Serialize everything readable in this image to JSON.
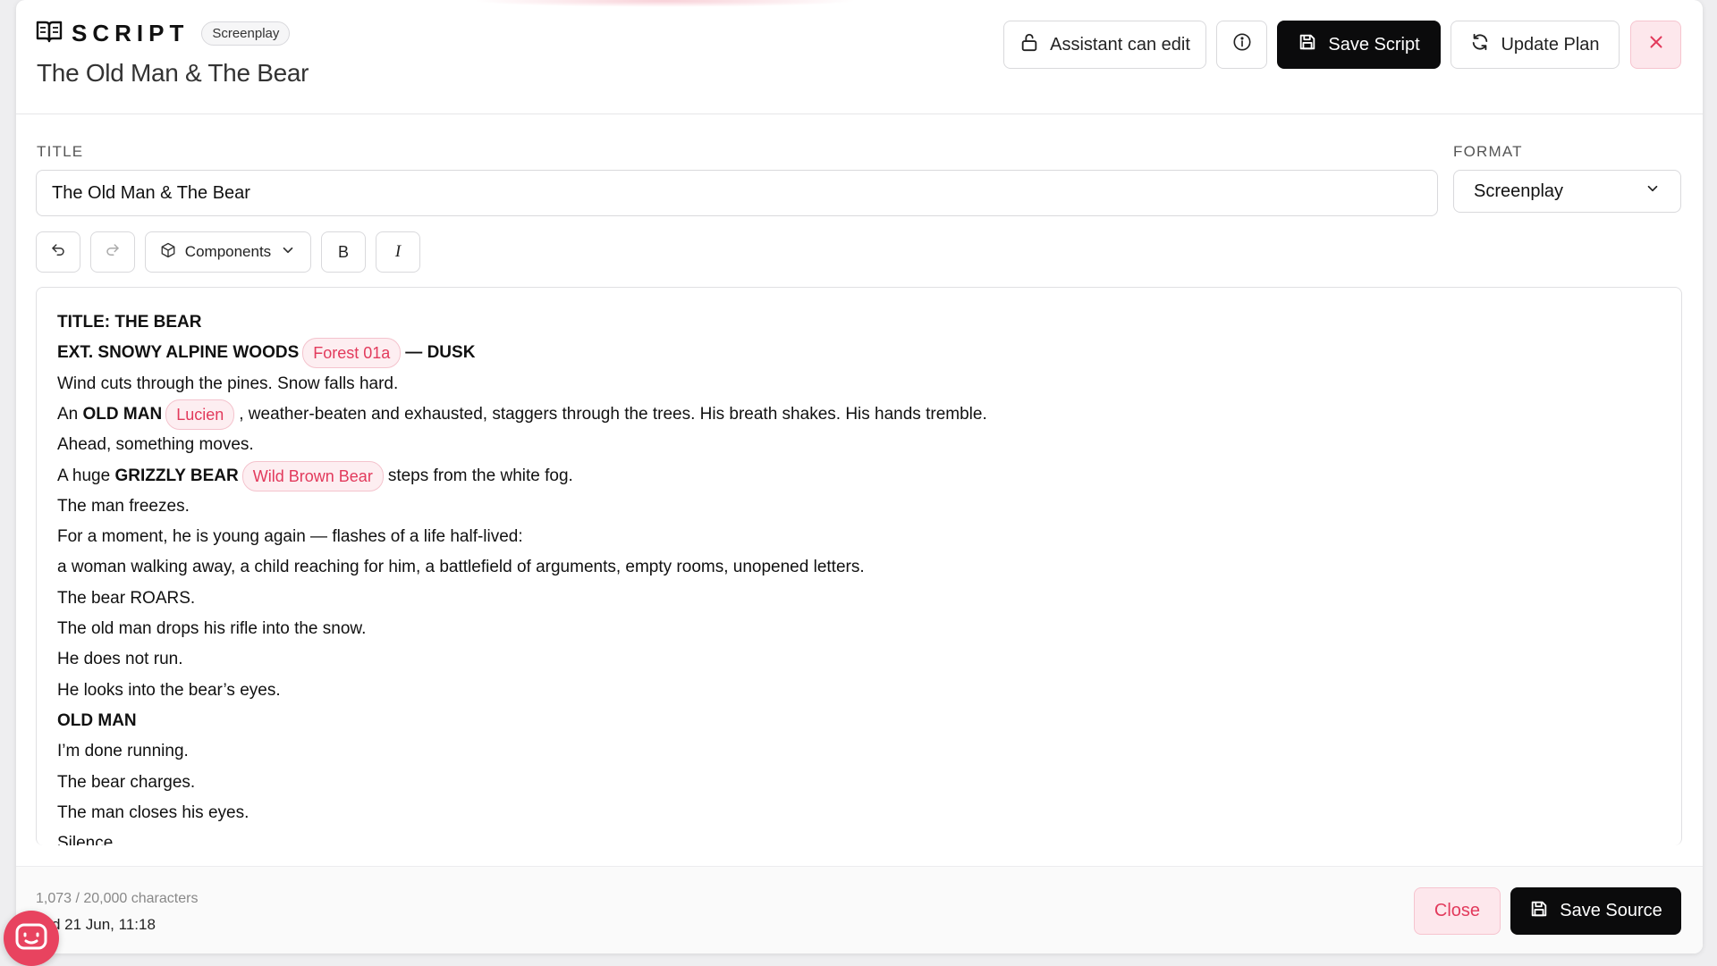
{
  "header": {
    "brand": "SCRIPT",
    "type_badge": "Screenplay",
    "doc_title": "The Old Man & The Bear",
    "assistant_label": "Assistant can edit",
    "save_script_label": "Save Script",
    "update_plan_label": "Update Plan"
  },
  "form": {
    "title_label": "TITLE",
    "title_value": "The Old Man & The Bear",
    "format_label": "FORMAT",
    "format_value": "Screenplay"
  },
  "toolbar": {
    "components_label": "Components",
    "bold_label": "B",
    "italic_label": "I"
  },
  "editor": {
    "lines": [
      {
        "bold": "TITLE: THE BEAR"
      },
      {
        "bold_a": "EXT. SNOWY ALPINE WOODS",
        "chip": "Forest 01a",
        "bold_b": "— DUSK"
      },
      {
        "text": "Wind cuts through the pines. Snow falls hard."
      },
      {
        "pre": "An ",
        "bold": "OLD MAN",
        "chip": "Lucien",
        "post": ", weather-beaten and exhausted, staggers through the trees. His breath shakes. His hands tremble."
      },
      {
        "text": "Ahead, something moves."
      },
      {
        "pre": "A huge ",
        "bold": "GRIZZLY BEAR",
        "chip": "Wild Brown Bear",
        "post": "steps from the white fog."
      },
      {
        "text": "The man freezes."
      },
      {
        "text": "For a moment, he is young again — flashes of a life half-lived:"
      },
      {
        "text": "a woman walking away, a child reaching for him, a battlefield of arguments, empty rooms, unopened letters."
      },
      {
        "text": "The bear ROARS."
      },
      {
        "text": "The old man drops his rifle into the snow."
      },
      {
        "text": "He does not run."
      },
      {
        "text": "He looks into the bear’s eyes."
      },
      {
        "bold": "OLD MAN"
      },
      {
        "text": "I’m done running."
      },
      {
        "text": "The bear charges."
      },
      {
        "text": "The man closes his eyes."
      },
      {
        "text": "Silence."
      }
    ]
  },
  "footer": {
    "char_count": "1,073 / 20,000 characters",
    "saved": "ved 21 Jun, 11:18",
    "close_label": "Close",
    "save_source_label": "Save Source"
  },
  "colors": {
    "accent": "#e8435f",
    "chip_text": "#e23a5c",
    "chip_bg": "#fdeef1",
    "primary_dark": "#0b0b0c"
  },
  "icons": {
    "brand": "open-book-icon",
    "assistant": "lock-open-icon",
    "info": "info-icon",
    "save": "floppy-disk-icon",
    "update": "refresh-icon",
    "close": "close-icon",
    "undo": "undo-icon",
    "redo": "redo-icon",
    "components": "cube-icon",
    "bot": "robot-face-icon"
  }
}
